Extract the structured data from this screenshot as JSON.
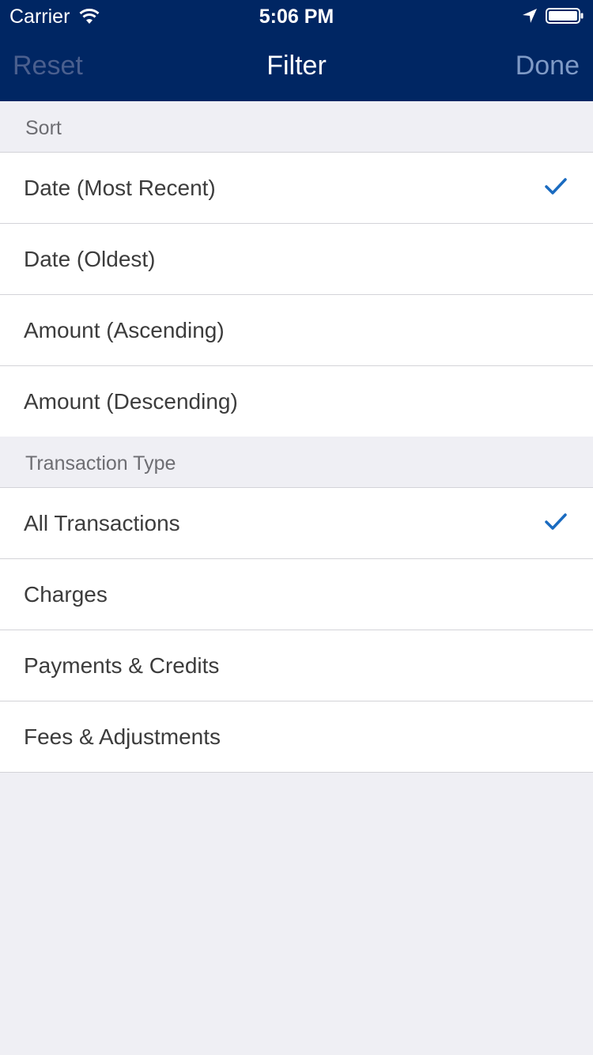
{
  "status_bar": {
    "carrier": "Carrier",
    "time": "5:06 PM",
    "icons": [
      "wifi-icon",
      "location-arrow-icon",
      "battery-icon"
    ]
  },
  "nav": {
    "left_label": "Reset",
    "title": "Filter",
    "right_label": "Done"
  },
  "colors": {
    "nav_background": "#002663",
    "check_accent": "#1a6bc0",
    "page_background": "#efeff4"
  },
  "sort": {
    "header": "Sort",
    "options": [
      {
        "label": "Date (Most Recent)",
        "selected": true
      },
      {
        "label": "Date (Oldest)",
        "selected": false
      },
      {
        "label": "Amount (Ascending)",
        "selected": false
      },
      {
        "label": "Amount (Descending)",
        "selected": false
      }
    ]
  },
  "transaction_type": {
    "header": "Transaction Type",
    "options": [
      {
        "label": "All Transactions",
        "selected": true
      },
      {
        "label": "Charges",
        "selected": false
      },
      {
        "label": "Payments & Credits",
        "selected": false
      },
      {
        "label": "Fees & Adjustments",
        "selected": false
      }
    ]
  }
}
